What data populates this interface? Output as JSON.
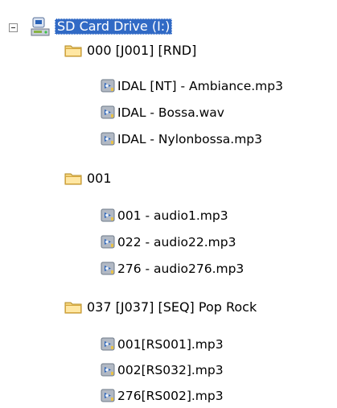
{
  "tree": {
    "drive": {
      "label": "SD Card Drive (I:)",
      "icon": "removable-drive-icon",
      "expanded": true,
      "selected": true
    },
    "folders": [
      {
        "label": "000 [J001] [RND]",
        "icon": "folder-icon",
        "files": [
          {
            "label": "IDAL [NT] - Ambiance.mp3",
            "icon": "audio-file-icon"
          },
          {
            "label": "IDAL - Bossa.wav",
            "icon": "audio-file-icon"
          },
          {
            "label": "IDAL - Nylonbossa.mp3",
            "icon": "audio-file-icon"
          }
        ]
      },
      {
        "label": "001",
        "icon": "folder-icon",
        "files": [
          {
            "label": "001 - audio1.mp3",
            "icon": "audio-file-icon"
          },
          {
            "label": "022 - audio22.mp3",
            "icon": "audio-file-icon"
          },
          {
            "label": "276 - audio276.mp3",
            "icon": "audio-file-icon"
          }
        ]
      },
      {
        "label": "037 [J037] [SEQ] Pop Rock",
        "icon": "folder-icon",
        "files": [
          {
            "label": "001[RS001].mp3",
            "icon": "audio-file-icon"
          },
          {
            "label": "002[RS032].mp3",
            "icon": "audio-file-icon"
          },
          {
            "label": "276[RS002].mp3",
            "icon": "audio-file-icon"
          }
        ]
      }
    ]
  },
  "colors": {
    "selection": "#316ac5",
    "folder": "#f4d27a",
    "file_blue": "#2a63b8",
    "file_bg": "#9aa7b6"
  }
}
